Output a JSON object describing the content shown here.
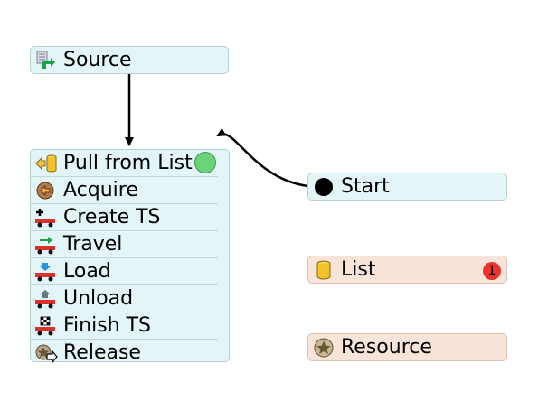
{
  "colors": {
    "flow_block_bg": "#e3f5f6",
    "shared_block_bg": "#f9e4d9",
    "active_indicator": "#6dd37b",
    "count_badge": "#e8342a",
    "connector": "#000000"
  },
  "source": {
    "label": "Source",
    "icon": "source-icon"
  },
  "process": {
    "activities": [
      {
        "label": "Pull from List",
        "icon": "pull-from-list-icon"
      },
      {
        "label": "Acquire",
        "icon": "acquire-icon"
      },
      {
        "label": "Create TS",
        "icon": "create-ts-icon"
      },
      {
        "label": "Travel",
        "icon": "travel-icon"
      },
      {
        "label": "Load",
        "icon": "load-icon"
      },
      {
        "label": "Unload",
        "icon": "unload-icon"
      },
      {
        "label": "Finish TS",
        "icon": "finish-ts-icon"
      },
      {
        "label": "Release",
        "icon": "release-icon"
      }
    ]
  },
  "start": {
    "label": "Start",
    "icon": "start-dot-icon"
  },
  "list": {
    "label": "List",
    "icon": "list-cylinder-icon",
    "count": "1"
  },
  "resource": {
    "label": "Resource",
    "icon": "resource-star-icon"
  }
}
